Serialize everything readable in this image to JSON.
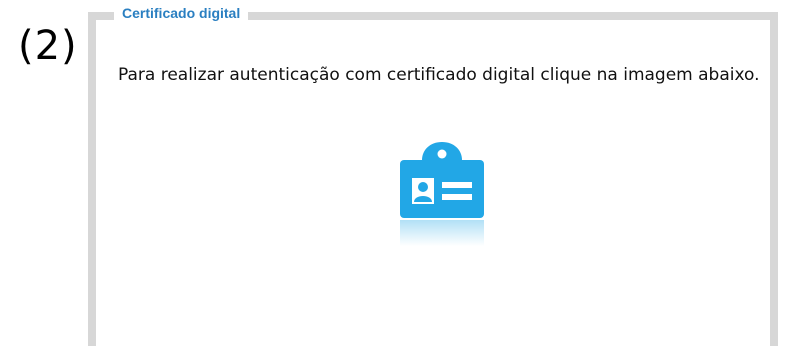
{
  "step_label": "(2)",
  "panel": {
    "legend": "Certificado digital",
    "instructions": "Para realizar autenticação com certificado digital clique na imagem abaixo.",
    "certificate_icon": "id-card-icon"
  },
  "colors": {
    "legend_text": "#2a7fc1",
    "icon_blue": "#22a7e6",
    "border_gray": "#d7d7d7"
  }
}
